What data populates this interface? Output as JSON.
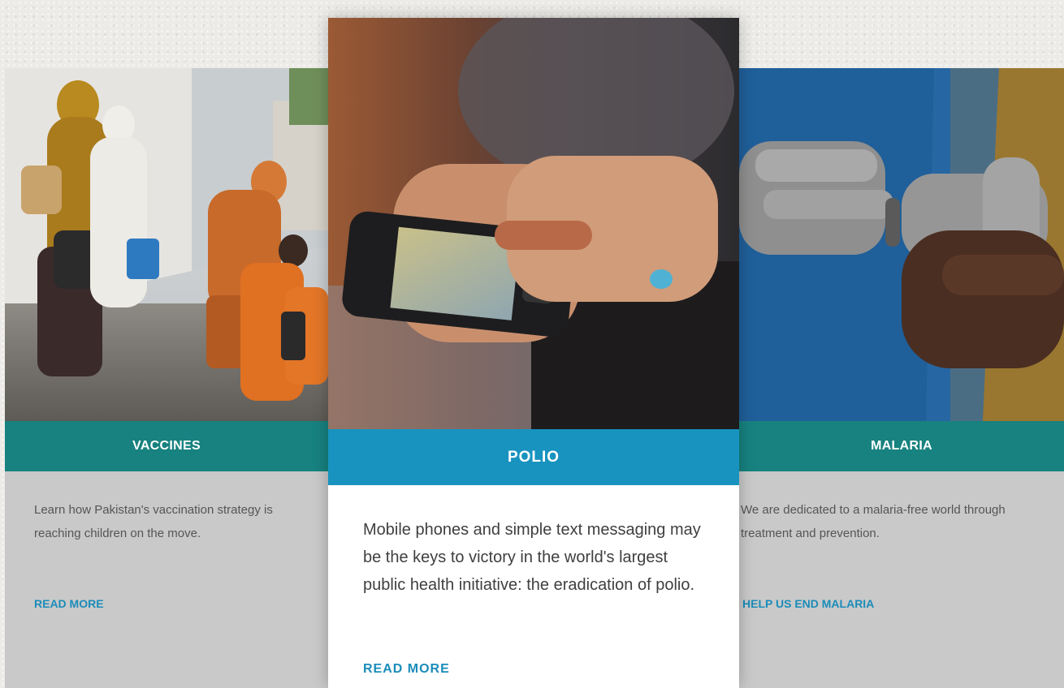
{
  "cards": [
    {
      "title": "VACCINES",
      "description": "Learn how Pakistan's vaccination strategy is reaching children on the move.",
      "link": "READ MORE"
    },
    {
      "title": "POLIO",
      "description": "Mobile phones and simple text messaging may be the keys to victory in the world's largest public health initiative: the eradication of polio.",
      "link": "READ MORE"
    },
    {
      "title": "MALARIA",
      "description": "We are dedicated to a malaria-free world through treatment and prevention.",
      "link": "HELP US END MALARIA"
    }
  ],
  "colors": {
    "teal_band": "#17827f",
    "blue_band": "#1893bf",
    "link": "#1b8cb9",
    "side_card_bg": "#c9c9c9"
  }
}
